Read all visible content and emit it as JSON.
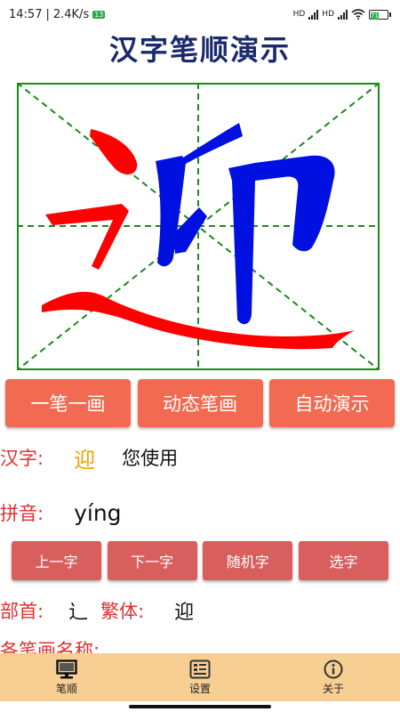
{
  "status": {
    "time": "14:57",
    "speed": "2.4K/s",
    "badge": "13",
    "net1": "HD",
    "net2": "HD",
    "battery": "71"
  },
  "title": "汉字笔顺演示",
  "character": {
    "glyph": "迎",
    "radical_color": "#ff0000",
    "body_color": "#0010e0",
    "grid_border_color": "#1a8a1a",
    "grid_line_color": "#1a8a1a"
  },
  "mode_buttons": [
    "一笔一画",
    "动态笔画",
    "自动演示"
  ],
  "info": {
    "hanzi_label": "汉字:",
    "hanzi_value": "迎",
    "usage_text": "您使用",
    "pinyin_label": "拼音:",
    "pinyin_value": "yíng",
    "radical_label": "部首:",
    "radical_value": "辶",
    "traditional_label": "繁体:",
    "traditional_value": "迎",
    "strokes_label": "各笔画名称:"
  },
  "nav_buttons": [
    "上一字",
    "下一字",
    "随机字",
    "选字"
  ],
  "bottom_nav": [
    {
      "label": "笔顺",
      "icon": "monitor-icon"
    },
    {
      "label": "设置",
      "icon": "settings-list-icon"
    },
    {
      "label": "关于",
      "icon": "info-icon"
    }
  ],
  "colors": {
    "title": "#1a2a6c",
    "big_button": "#f26a52",
    "small_button": "#d95f5f",
    "label": "#e03030",
    "char_value": "#f5a000",
    "bottom_nav_bg": "#f8cf93"
  }
}
